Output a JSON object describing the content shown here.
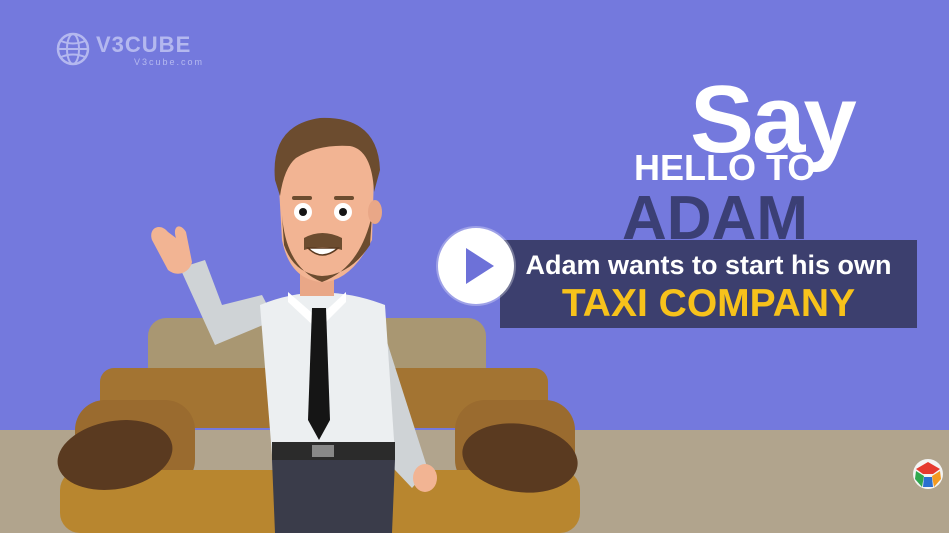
{
  "logo": {
    "name": "V3CUBE",
    "sub": "V3cube.com"
  },
  "headline": {
    "say": "Say",
    "hello_to": "HELLO TO",
    "name": "ADAM"
  },
  "banner": {
    "line1": "Adam wants to start his own",
    "line2": "TAXI COMPANY"
  },
  "video": {
    "play_icon": "play-icon"
  },
  "colors": {
    "background": "#7479dd",
    "floor": "#b1a48d",
    "banner": "#3c3f6e",
    "highlight": "#f7c21b",
    "name_text": "#3b3f75"
  }
}
